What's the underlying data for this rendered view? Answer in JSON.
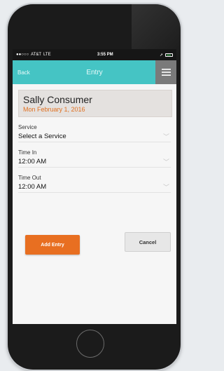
{
  "status_bar": {
    "carrier": "AT&T",
    "network": "LTE",
    "time": "3:55 PM"
  },
  "nav": {
    "back_label": "Back",
    "title": "Entry",
    "menu_icon": "hamburger-icon"
  },
  "consumer": {
    "name": "Sally Consumer",
    "date": "Mon February 1, 2016"
  },
  "form": {
    "service": {
      "label": "Service",
      "value": "Select a Service"
    },
    "time_in": {
      "label": "Time In",
      "value": "12:00 AM"
    },
    "time_out": {
      "label": "Time Out",
      "value": "12:00 AM"
    }
  },
  "actions": {
    "add_label": "Add Entry",
    "cancel_label": "Cancel"
  },
  "colors": {
    "nav_bg": "#45c4c4",
    "menu_bg": "#7a7a7a",
    "accent_orange": "#e86f21",
    "date_text": "#e07020"
  }
}
